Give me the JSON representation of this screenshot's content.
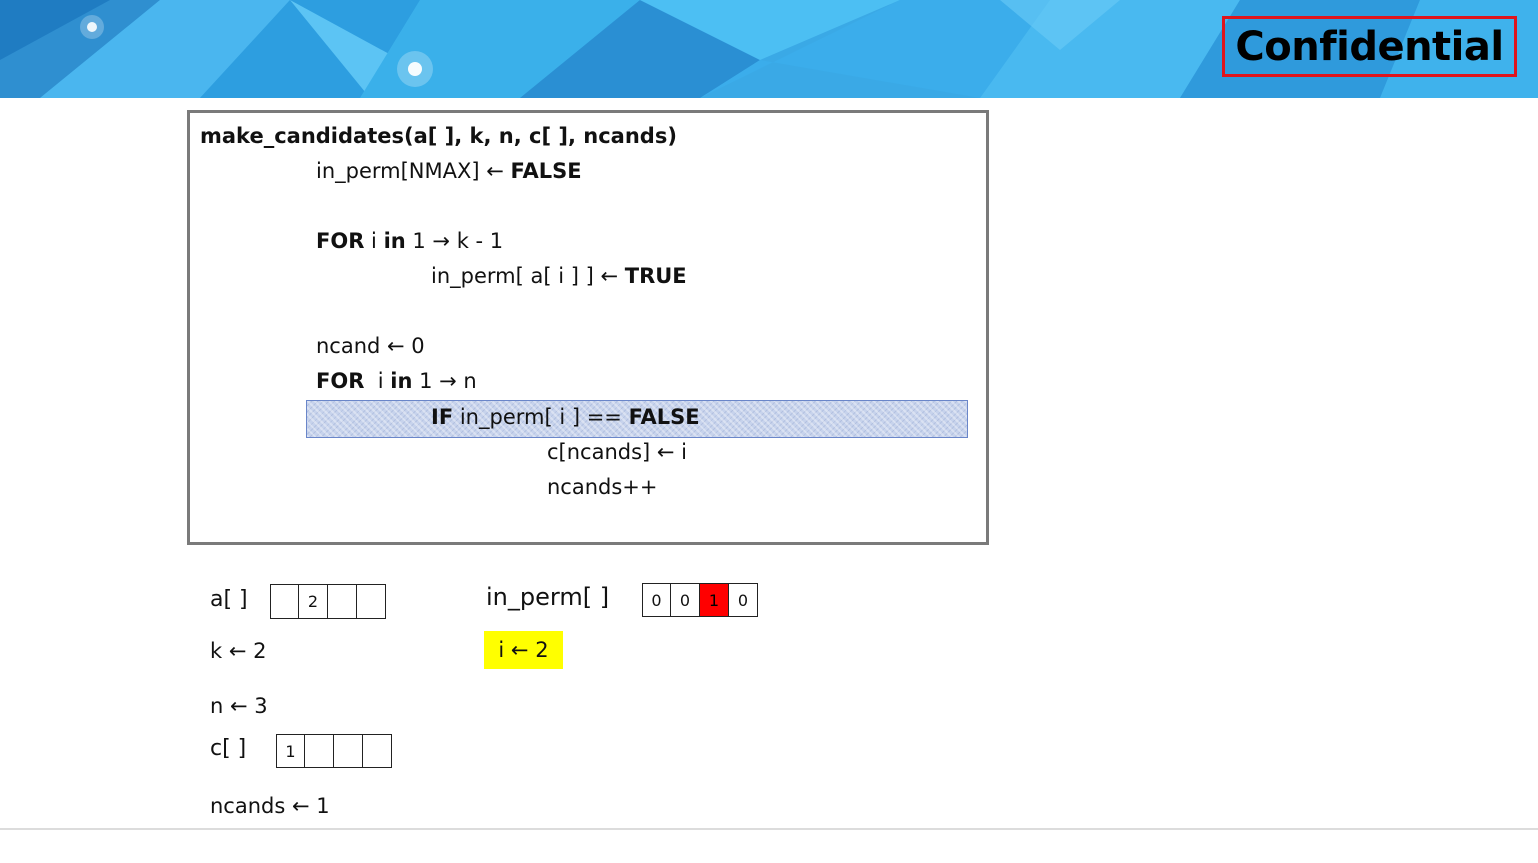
{
  "banner": {
    "confidential_label": "Confidential",
    "colors": {
      "sky": "#3aa9e6",
      "frame": "#e0141c"
    }
  },
  "code": {
    "signature": "make_candidates(a[ ], k, n, c[ ], ncands)",
    "line1_a": "in_perm[NMAX] ← ",
    "line1_b": "FALSE",
    "for1_kw": "FOR",
    "for1_var": " i ",
    "for1_in": "in",
    "for1_range": " 1 → k - 1",
    "assign_a": "in_perm[ a[ i ] ] ← ",
    "assign_b": "TRUE",
    "ncand_init": "ncand ← 0",
    "for2_kw": "FOR",
    "for2_var": "  i ",
    "for2_in": "in",
    "for2_range": " 1 → n",
    "if_kw": "IF",
    "if_cond": " in_perm[ i ] == ",
    "if_val": "FALSE",
    "c_assign": "c[ncands] ← i",
    "ncands_inc": "ncands++"
  },
  "state": {
    "a_label": "a[ ]",
    "a_cells": [
      "",
      "2",
      "",
      ""
    ],
    "k_label": "k ← 2",
    "n_label": "n ← 3",
    "c_label": "c[ ]",
    "c_cells": [
      "1",
      "",
      "",
      ""
    ],
    "ncands_label": "ncands ← 1",
    "in_perm_label": "in_perm[ ]",
    "in_perm_cells": [
      "0",
      "0",
      "1",
      "0"
    ],
    "in_perm_highlight_index": 2,
    "i_label": "i ← 2",
    "colors": {
      "highlight_cell": "#ff0000",
      "current_var": "#ffff00",
      "current_line": "#c7d3ec"
    }
  }
}
